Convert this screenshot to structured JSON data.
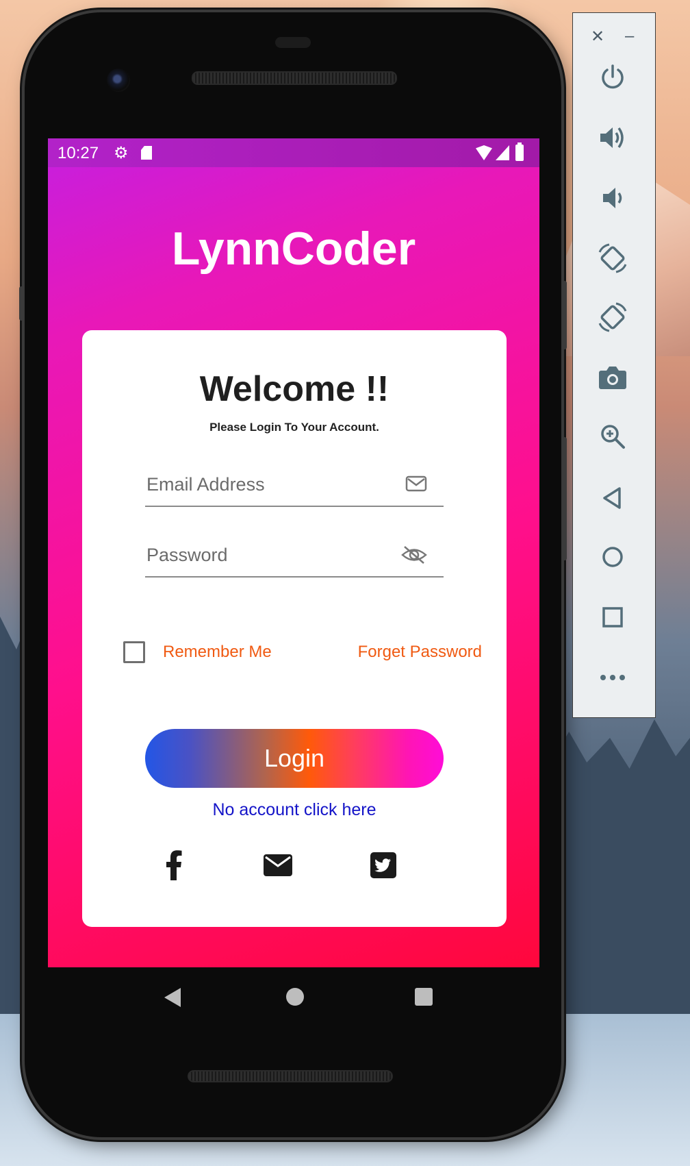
{
  "status_bar": {
    "time": "10:27",
    "icons": [
      "gear-icon",
      "sd-card-icon",
      "wifi-icon",
      "signal-icon",
      "battery-icon"
    ]
  },
  "app": {
    "title": "LynnCoder"
  },
  "login_card": {
    "welcome": "Welcome !!",
    "subtitle": "Please Login To Your Account.",
    "email_placeholder": "Email Address",
    "password_placeholder": "Password",
    "remember_label": "Remember Me",
    "remember_checked": false,
    "forget_label": "Forget Password",
    "login_label": "Login",
    "no_account_label": "No account click here",
    "social": [
      "facebook-icon",
      "mail-icon",
      "twitter-icon"
    ]
  },
  "colors": {
    "link_orange": "#f05a12",
    "link_blue": "#1414c8",
    "gradient_start": "#c51fe0",
    "gradient_end": "#ff073c"
  },
  "emulator_panel": {
    "controls": [
      "close",
      "minimize",
      "power",
      "volume-up",
      "volume-down",
      "rotate-left",
      "rotate-right",
      "screenshot",
      "zoom",
      "back",
      "home",
      "overview",
      "more"
    ]
  }
}
